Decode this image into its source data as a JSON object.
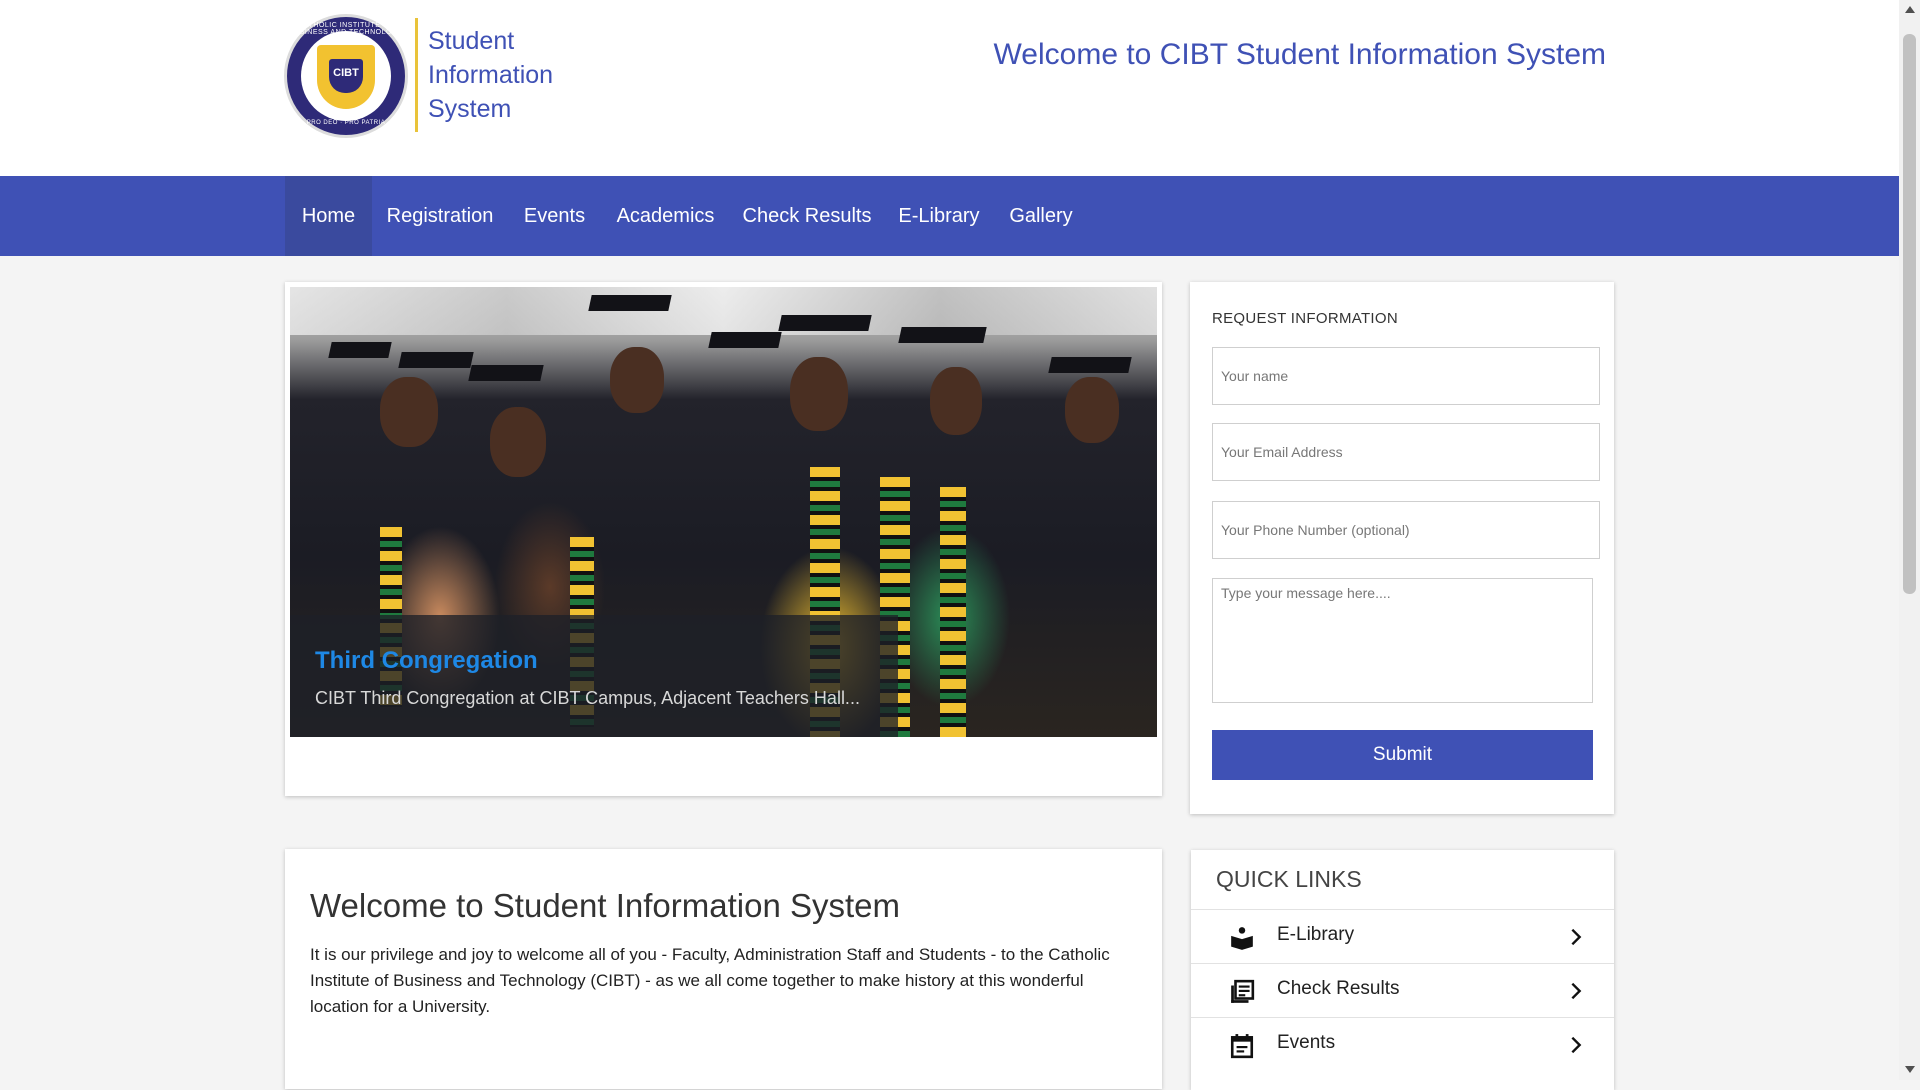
{
  "header": {
    "logo_seal_top": "CATHOLIC INSTITUTE OF BUSINESS AND TECHNOLOGY",
    "logo_seal_center": "CIBT",
    "logo_seal_bottom": "PRO DEO · PRO PATRIA",
    "logo_text": [
      "Student",
      "Information",
      "System"
    ],
    "welcome_title": "Welcome to CIBT Student Information System"
  },
  "nav": {
    "items": [
      {
        "label": "Home",
        "active": true
      },
      {
        "label": "Registration"
      },
      {
        "label": "Events"
      },
      {
        "label": "Academics"
      },
      {
        "label": "Check Results"
      },
      {
        "label": "E-Library"
      },
      {
        "label": "Gallery"
      }
    ]
  },
  "slider": {
    "caption_title": "Third Congregation",
    "caption_text": "CIBT Third Congregation at CIBT Campus, Adjacent Teachers Hall..."
  },
  "request_form": {
    "title": "REQUEST INFORMATION",
    "name_placeholder": "Your name",
    "email_placeholder": "Your Email Address",
    "phone_placeholder": "Your Phone Number (optional)",
    "message_placeholder": "Type your message here....",
    "submit_label": "Submit"
  },
  "welcome": {
    "heading": "Welcome to Student Information System",
    "body": "It is our privilege and joy to welcome all of you - Faculty, Administration Staff and Students - to the Catholic Institute of Business and Technology (CIBT) - as we all come together to make history at this wonderful location for a University."
  },
  "quick_links": {
    "title": "QUICK LINKS",
    "items": [
      {
        "label": "E-Library",
        "icon": "reader-icon"
      },
      {
        "label": "Check Results",
        "icon": "library-books-icon"
      },
      {
        "label": "Events",
        "icon": "calendar-icon"
      }
    ]
  },
  "colors": {
    "primary": "#3f51b5",
    "nav_active": "#3a4a9e",
    "caption_title": "#1e88e5",
    "logo_gold": "#e9c33a",
    "page_bg": "#f4f4f4"
  }
}
